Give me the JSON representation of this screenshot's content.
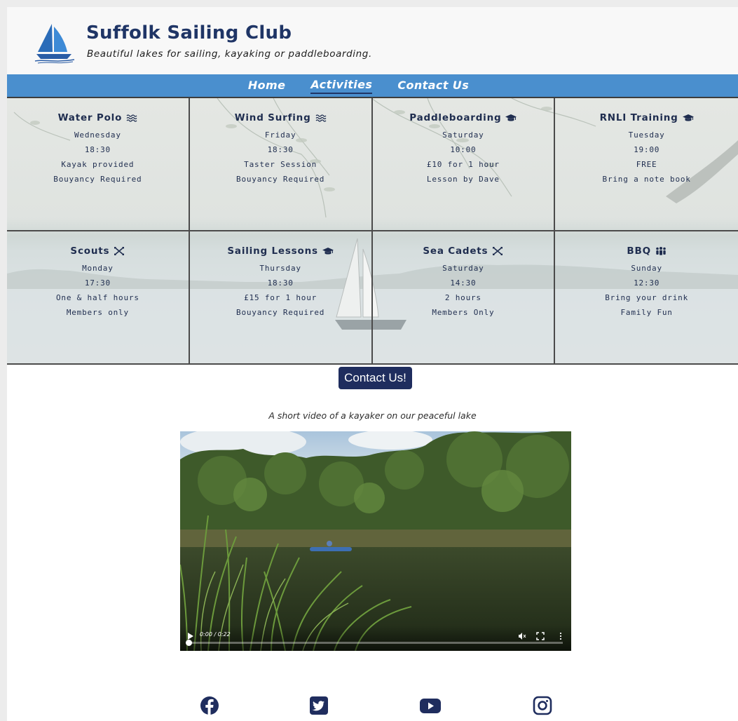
{
  "header": {
    "title": "Suffolk Sailing Club",
    "tagline": "Beautiful lakes for sailing, kayaking or paddleboarding."
  },
  "nav": {
    "items": [
      {
        "label": "Home",
        "active": false
      },
      {
        "label": "Activities",
        "active": true
      },
      {
        "label": "Contact Us",
        "active": false
      }
    ]
  },
  "activities": [
    {
      "title": "Water Polo",
      "icon": "water-waves-icon",
      "lines": [
        "Wednesday",
        "18:30",
        "Kayak provided",
        "Bouyancy Required"
      ]
    },
    {
      "title": "Wind Surfing",
      "icon": "water-waves-icon",
      "lines": [
        "Friday",
        "18:30",
        "Taster Session",
        "Bouyancy Required"
      ]
    },
    {
      "title": "Paddleboarding",
      "icon": "graduation-cap-icon",
      "lines": [
        "Saturday",
        "10:00",
        "£10 for 1 hour",
        "Lesson by Dave"
      ]
    },
    {
      "title": "RNLI Training",
      "icon": "graduation-cap-icon",
      "lines": [
        "Tuesday",
        "19:00",
        "FREE",
        "Bring a note book"
      ]
    },
    {
      "title": "Scouts",
      "icon": "crossed-arrows-icon",
      "lines": [
        "Monday",
        "17:30",
        "One & half hours",
        "Members only"
      ]
    },
    {
      "title": "Sailing Lessons",
      "icon": "graduation-cap-icon",
      "lines": [
        "Thursday",
        "18:30",
        "£15 for 1 hour",
        "Bouyancy Required"
      ]
    },
    {
      "title": "Sea Cadets",
      "icon": "crossed-arrows-icon",
      "lines": [
        "Saturday",
        "14:30",
        "2 hours",
        "Members Only"
      ]
    },
    {
      "title": "BBQ",
      "icon": "people-group-icon",
      "lines": [
        "Sunday",
        "12:30",
        "Bring your drink",
        "Family Fun"
      ]
    }
  ],
  "contact_button": {
    "label": "Contact Us!"
  },
  "video": {
    "caption": "A short video of a kayaker on our peaceful lake",
    "time": "0:00 / 0:22",
    "progress": 0.0
  },
  "social": {
    "icons": [
      "facebook-icon",
      "twitter-icon",
      "youtube-icon",
      "instagram-icon"
    ]
  },
  "colors": {
    "nav": "#4a8fce",
    "brand_dark": "#1f2d5e",
    "title": "#1f3566"
  }
}
